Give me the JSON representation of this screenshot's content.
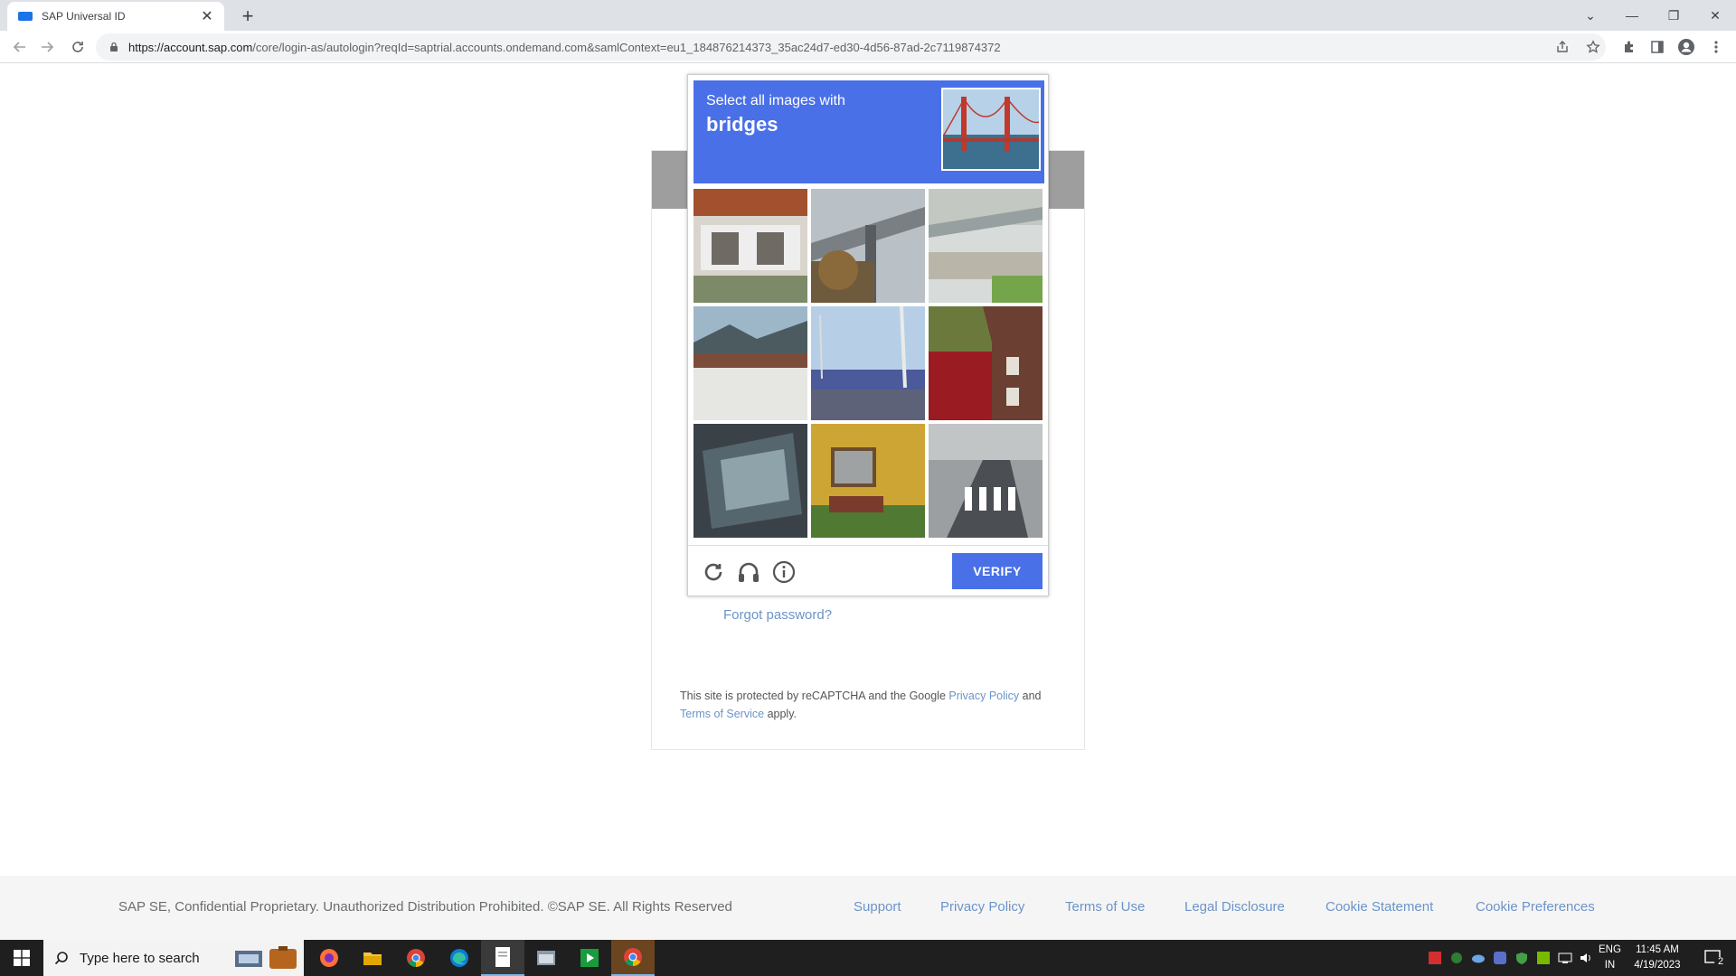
{
  "browser": {
    "tab_title": "SAP Universal ID",
    "url_host": "https://account.sap.com",
    "url_path": "/core/login-as/autologin?reqId=saptrial.accounts.ondemand.com&samlContext=eu1_184876214373_35ac24d7-ed30-4d56-87ad-2c7119874372"
  },
  "captcha": {
    "prompt": "Select all images with",
    "target": "bridges",
    "verify_label": "VERIFY"
  },
  "login": {
    "forgot_password": "Forgot password?",
    "recaptcha_text_1": "This site is protected by reCAPTCHA and the Google",
    "privacy_policy": "Privacy Policy",
    "and": "and",
    "terms_of_service": "Terms of Service",
    "apply": "apply."
  },
  "footer": {
    "copyright": "SAP SE, Confidential Proprietary. Unauthorized Distribution Prohibited. ©SAP SE. All Rights Reserved",
    "links": [
      "Support",
      "Privacy Policy",
      "Terms of Use",
      "Legal Disclosure",
      "Cookie Statement",
      "Cookie Preferences"
    ]
  },
  "taskbar": {
    "search_placeholder": "Type here to search",
    "time": "11:45 AM",
    "date": "4/19/2023",
    "lang_1": "ENG",
    "lang_2": "IN",
    "notification_count": "2"
  },
  "colors": {
    "captcha_blue": "#4a70e8",
    "link_blue": "#6b94c9",
    "chrome_gray": "#dee1e6"
  }
}
